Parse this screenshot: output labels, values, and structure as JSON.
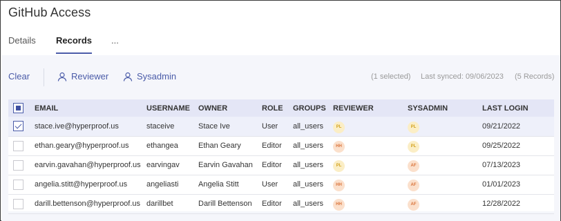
{
  "title": "GitHub Access",
  "tabs": [
    {
      "label": "Details"
    },
    {
      "label": "Records"
    },
    {
      "label": "..."
    }
  ],
  "toolbar": {
    "clear_label": "Clear",
    "reviewer_label": "Reviewer",
    "sysadmin_label": "Sysadmin",
    "selected_text": "(1 selected)",
    "synced_text": "Last synced: 09/06/2023",
    "records_text": "(5 Records)"
  },
  "table": {
    "headers": [
      "EMAIL",
      "USERNAME",
      "OWNER",
      "ROLE",
      "GROUPS",
      "REVIEWER",
      "SYSADMIN",
      "LAST LOGIN"
    ],
    "rows": [
      {
        "email": "stace.ive@hyperproof.us",
        "username": "staceive",
        "owner": "Stace Ive",
        "role": "User",
        "groups": "all_users",
        "reviewer": "PL",
        "sysadmin": "PL",
        "last_login": "09/21/2022"
      },
      {
        "email": "ethan.geary@hyperproof.us",
        "username": "ethangea",
        "owner": "Ethan Geary",
        "role": "Editor",
        "groups": "all_users",
        "reviewer": "HH",
        "sysadmin": "PL",
        "last_login": "09/25/2022"
      },
      {
        "email": "earvin.gavahan@hyperproof.us",
        "username": "earvingav",
        "owner": "Earvin Gavahan",
        "role": "Editor",
        "groups": "all_users",
        "reviewer": "PL",
        "sysadmin": "AF",
        "last_login": "07/13/2023"
      },
      {
        "email": "angelia.stitt@hyperproof.us",
        "username": "angeliasti",
        "owner": "Angelia Stitt",
        "role": "User",
        "groups": "all_users",
        "reviewer": "HH",
        "sysadmin": "AF",
        "last_login": "01/01/2023"
      },
      {
        "email": "darill.bettenson@hyperproof.us",
        "username": "darillbet",
        "owner": "Darill Bettenson",
        "role": "Editor",
        "groups": "all_users",
        "reviewer": "HH",
        "sysadmin": "AF",
        "last_login": "12/28/2022"
      }
    ]
  },
  "colors": {
    "accent": "#4a5ba8",
    "header_bg": "#e4e6f6",
    "avatar_pl_bg": "#fbeec6",
    "avatar_hh_af_bg": "#fbe0cc"
  }
}
